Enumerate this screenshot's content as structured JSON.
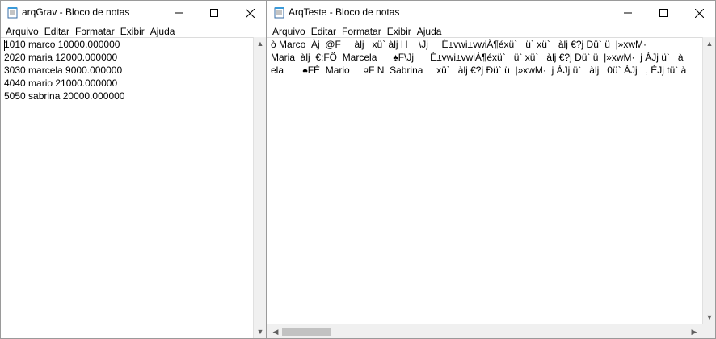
{
  "left_window": {
    "title": "arqGrav - Bloco de notas",
    "menu": [
      "Arquivo",
      "Editar",
      "Formatar",
      "Exibir",
      "Ajuda"
    ],
    "lines": [
      "1010 marco 10000.000000",
      "2020 maria 12000.000000",
      "3030 marcela 9000.000000",
      "4040 mario 21000.000000",
      "5050 sabrina 20000.000000"
    ]
  },
  "right_window": {
    "title": "ArqTeste - Bloco de notas",
    "menu": [
      "Arquivo",
      "Editar",
      "Formatar",
      "Exibir",
      "Ajuda"
    ],
    "lines": [
      "ò Marco  Àj  @F     àlj   xü` àlj H    \\Jj     È±vwi±vwiÀ¶éxü`   ü` xü`   àlj €?j Ðü` ü  |»xwM·",
      "Maria  àlj  €;FÖ  Marcela      ♠F\\Jj      È±vwi±vwiÀ¶éxü`   ü` xü`   àlj €?j Ðü` ü  |»xwM·  j ÀJj ü`   à",
      "ela       ♠FÈ  Mario     ¤F N  Sabrina     xü`   àlj €?j Ðü` ü  |»xwM·  j ÀJj ü`   àlj   0ü` ÀJj   , ÈJj tü` à"
    ]
  },
  "colors": {
    "window_bg": "#ffffff",
    "scroll_bg": "#f0f0f0",
    "thumb": "#c2c2c2"
  }
}
